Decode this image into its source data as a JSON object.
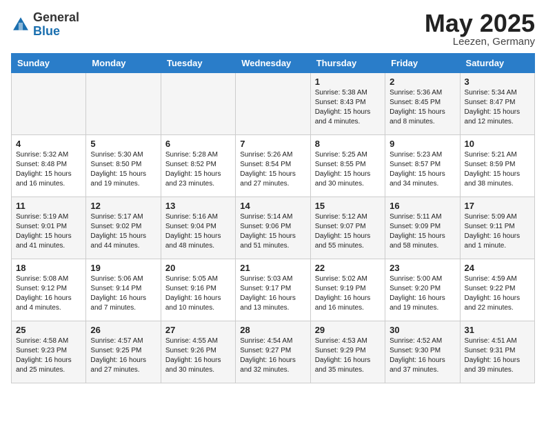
{
  "header": {
    "logo_general": "General",
    "logo_blue": "Blue",
    "month": "May 2025",
    "location": "Leezen, Germany"
  },
  "days_of_week": [
    "Sunday",
    "Monday",
    "Tuesday",
    "Wednesday",
    "Thursday",
    "Friday",
    "Saturday"
  ],
  "weeks": [
    [
      {
        "num": "",
        "info": ""
      },
      {
        "num": "",
        "info": ""
      },
      {
        "num": "",
        "info": ""
      },
      {
        "num": "",
        "info": ""
      },
      {
        "num": "1",
        "info": "Sunrise: 5:38 AM\nSunset: 8:43 PM\nDaylight: 15 hours\nand 4 minutes."
      },
      {
        "num": "2",
        "info": "Sunrise: 5:36 AM\nSunset: 8:45 PM\nDaylight: 15 hours\nand 8 minutes."
      },
      {
        "num": "3",
        "info": "Sunrise: 5:34 AM\nSunset: 8:47 PM\nDaylight: 15 hours\nand 12 minutes."
      }
    ],
    [
      {
        "num": "4",
        "info": "Sunrise: 5:32 AM\nSunset: 8:48 PM\nDaylight: 15 hours\nand 16 minutes."
      },
      {
        "num": "5",
        "info": "Sunrise: 5:30 AM\nSunset: 8:50 PM\nDaylight: 15 hours\nand 19 minutes."
      },
      {
        "num": "6",
        "info": "Sunrise: 5:28 AM\nSunset: 8:52 PM\nDaylight: 15 hours\nand 23 minutes."
      },
      {
        "num": "7",
        "info": "Sunrise: 5:26 AM\nSunset: 8:54 PM\nDaylight: 15 hours\nand 27 minutes."
      },
      {
        "num": "8",
        "info": "Sunrise: 5:25 AM\nSunset: 8:55 PM\nDaylight: 15 hours\nand 30 minutes."
      },
      {
        "num": "9",
        "info": "Sunrise: 5:23 AM\nSunset: 8:57 PM\nDaylight: 15 hours\nand 34 minutes."
      },
      {
        "num": "10",
        "info": "Sunrise: 5:21 AM\nSunset: 8:59 PM\nDaylight: 15 hours\nand 38 minutes."
      }
    ],
    [
      {
        "num": "11",
        "info": "Sunrise: 5:19 AM\nSunset: 9:01 PM\nDaylight: 15 hours\nand 41 minutes."
      },
      {
        "num": "12",
        "info": "Sunrise: 5:17 AM\nSunset: 9:02 PM\nDaylight: 15 hours\nand 44 minutes."
      },
      {
        "num": "13",
        "info": "Sunrise: 5:16 AM\nSunset: 9:04 PM\nDaylight: 15 hours\nand 48 minutes."
      },
      {
        "num": "14",
        "info": "Sunrise: 5:14 AM\nSunset: 9:06 PM\nDaylight: 15 hours\nand 51 minutes."
      },
      {
        "num": "15",
        "info": "Sunrise: 5:12 AM\nSunset: 9:07 PM\nDaylight: 15 hours\nand 55 minutes."
      },
      {
        "num": "16",
        "info": "Sunrise: 5:11 AM\nSunset: 9:09 PM\nDaylight: 15 hours\nand 58 minutes."
      },
      {
        "num": "17",
        "info": "Sunrise: 5:09 AM\nSunset: 9:11 PM\nDaylight: 16 hours\nand 1 minute."
      }
    ],
    [
      {
        "num": "18",
        "info": "Sunrise: 5:08 AM\nSunset: 9:12 PM\nDaylight: 16 hours\nand 4 minutes."
      },
      {
        "num": "19",
        "info": "Sunrise: 5:06 AM\nSunset: 9:14 PM\nDaylight: 16 hours\nand 7 minutes."
      },
      {
        "num": "20",
        "info": "Sunrise: 5:05 AM\nSunset: 9:16 PM\nDaylight: 16 hours\nand 10 minutes."
      },
      {
        "num": "21",
        "info": "Sunrise: 5:03 AM\nSunset: 9:17 PM\nDaylight: 16 hours\nand 13 minutes."
      },
      {
        "num": "22",
        "info": "Sunrise: 5:02 AM\nSunset: 9:19 PM\nDaylight: 16 hours\nand 16 minutes."
      },
      {
        "num": "23",
        "info": "Sunrise: 5:00 AM\nSunset: 9:20 PM\nDaylight: 16 hours\nand 19 minutes."
      },
      {
        "num": "24",
        "info": "Sunrise: 4:59 AM\nSunset: 9:22 PM\nDaylight: 16 hours\nand 22 minutes."
      }
    ],
    [
      {
        "num": "25",
        "info": "Sunrise: 4:58 AM\nSunset: 9:23 PM\nDaylight: 16 hours\nand 25 minutes."
      },
      {
        "num": "26",
        "info": "Sunrise: 4:57 AM\nSunset: 9:25 PM\nDaylight: 16 hours\nand 27 minutes."
      },
      {
        "num": "27",
        "info": "Sunrise: 4:55 AM\nSunset: 9:26 PM\nDaylight: 16 hours\nand 30 minutes."
      },
      {
        "num": "28",
        "info": "Sunrise: 4:54 AM\nSunset: 9:27 PM\nDaylight: 16 hours\nand 32 minutes."
      },
      {
        "num": "29",
        "info": "Sunrise: 4:53 AM\nSunset: 9:29 PM\nDaylight: 16 hours\nand 35 minutes."
      },
      {
        "num": "30",
        "info": "Sunrise: 4:52 AM\nSunset: 9:30 PM\nDaylight: 16 hours\nand 37 minutes."
      },
      {
        "num": "31",
        "info": "Sunrise: 4:51 AM\nSunset: 9:31 PM\nDaylight: 16 hours\nand 39 minutes."
      }
    ]
  ]
}
